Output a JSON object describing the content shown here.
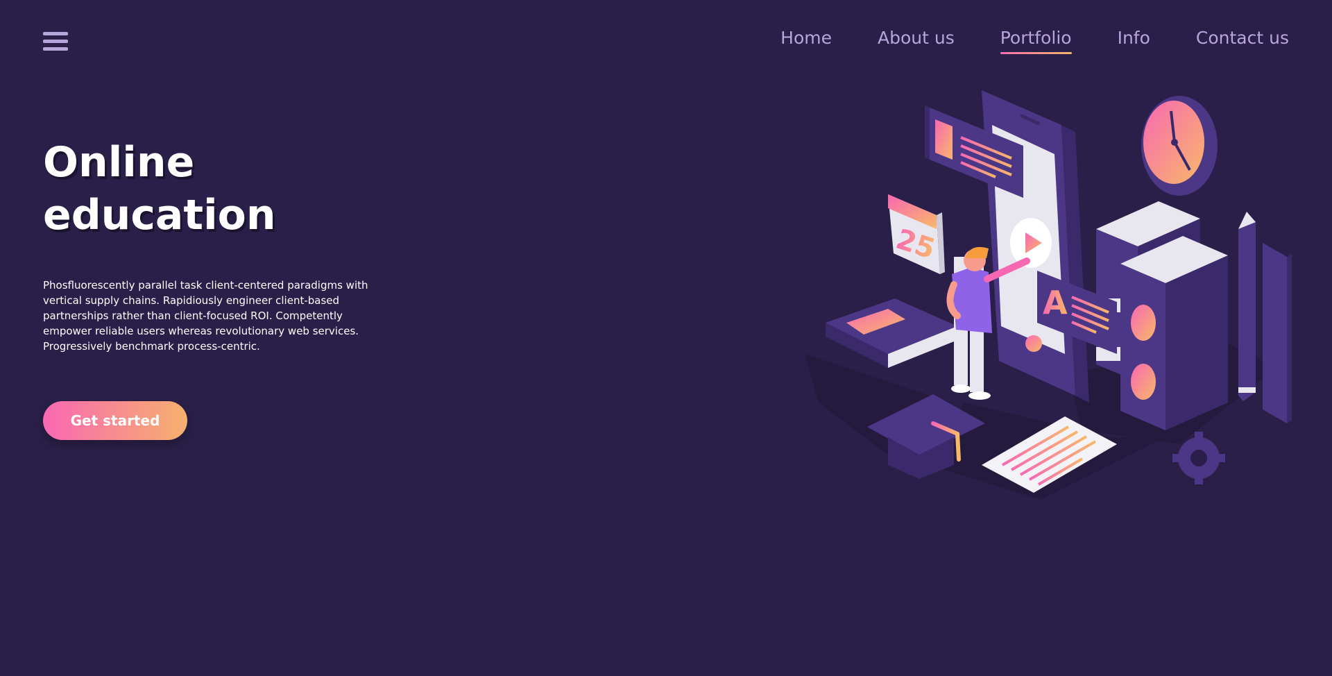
{
  "header": {
    "menu_icon": "hamburger-menu-icon",
    "nav": {
      "items": [
        {
          "label": "Home"
        },
        {
          "label": "About us"
        },
        {
          "label": "Portfolio",
          "active": true
        },
        {
          "label": "Info"
        },
        {
          "label": "Contact us"
        }
      ]
    }
  },
  "hero": {
    "title": "Online\neducation",
    "description": "Phosfluorescently parallel task client-centered paradigms with vertical supply chains. Rapidiously engineer client-based partnerships rather than client-focused ROI. Competently empower reliable users whereas revolutionary web services. Progressively benchmark process-centric.",
    "cta_label": "Get started"
  },
  "illustration": {
    "calendar_day": "25",
    "tag_letter": "A"
  },
  "colors": {
    "background": "#2a1f48",
    "nav_text": "#b7a6dc",
    "accent_pink": "#f868b2",
    "accent_orange": "#f6b06e",
    "purple": "#4b3785",
    "light_purple": "#8e63e8"
  }
}
